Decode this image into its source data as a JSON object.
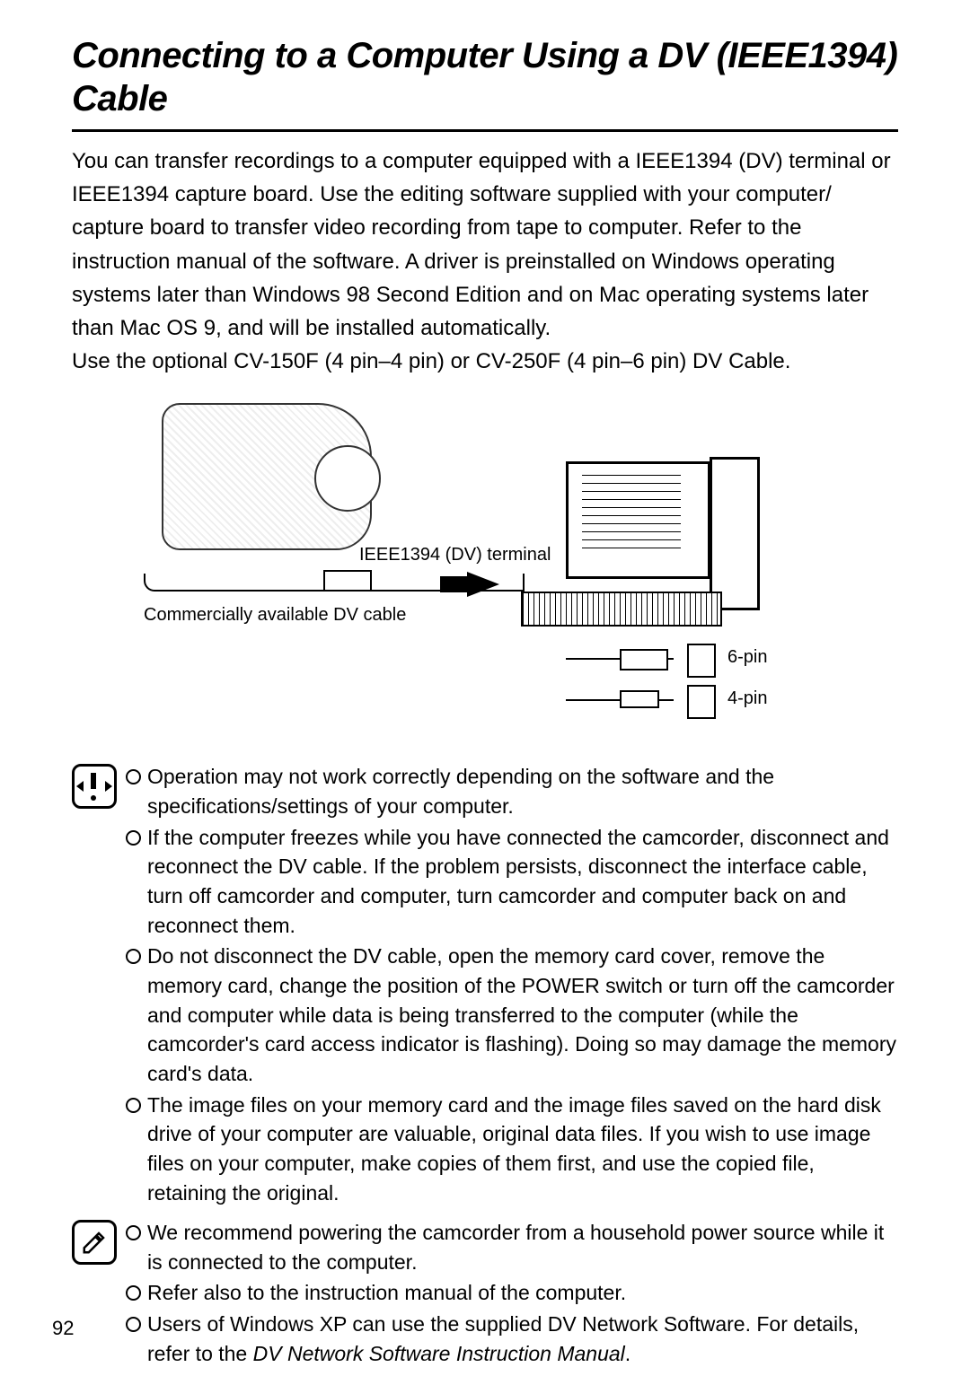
{
  "title": "Connecting to a Computer Using a DV (IEEE1394) Cable",
  "intro": "You can transfer recordings to a computer equipped with a IEEE1394 (DV) terminal or IEEE1394 capture board. Use the editing software supplied with your computer/ capture board to transfer video recording from tape to computer. Refer to the instruction manual of the software. A driver is preinstalled on Windows operating systems later than Windows 98 Second Edition and on Mac operating systems later than Mac OS 9, and will be installed automatically.",
  "intro2": "Use the optional CV-150F (4 pin–4 pin) or CV-250F (4 pin–6 pin) DV Cable.",
  "diagram": {
    "terminal_label": "IEEE1394 (DV) terminal",
    "cable_label": "Commercially available DV cable",
    "pin6": "6-pin",
    "pin4": "4-pin"
  },
  "cautions": [
    "Operation may not work correctly depending on the software and the specifications/settings of your computer.",
    "If the computer freezes while you have connected the camcorder, disconnect and reconnect the DV cable. If the problem persists, disconnect the interface cable, turn off camcorder and computer, turn camcorder and computer back on and reconnect them.",
    "Do not disconnect the DV cable, open the memory card cover, remove the memory card, change the position of the POWER switch or turn off the camcorder and computer while data is being transferred to the computer (while the camcorder's card access indicator is flashing). Doing so may damage the memory card's data.",
    "The image files on your memory card and the image files saved on the hard disk drive of your computer are valuable, original data files. If you wish to use image files on your computer, make copies of them first, and use the copied file, retaining the original."
  ],
  "notes": [
    "We recommend powering the camcorder from a household power source while it is connected to the computer.",
    "Refer also to the instruction manual of the computer.",
    "Users of Windows XP can use the supplied DV Network Software. For details, refer to the "
  ],
  "manual_ref": "DV Network Software Instruction Manual",
  "note3_tail": ".",
  "page_number": "92"
}
